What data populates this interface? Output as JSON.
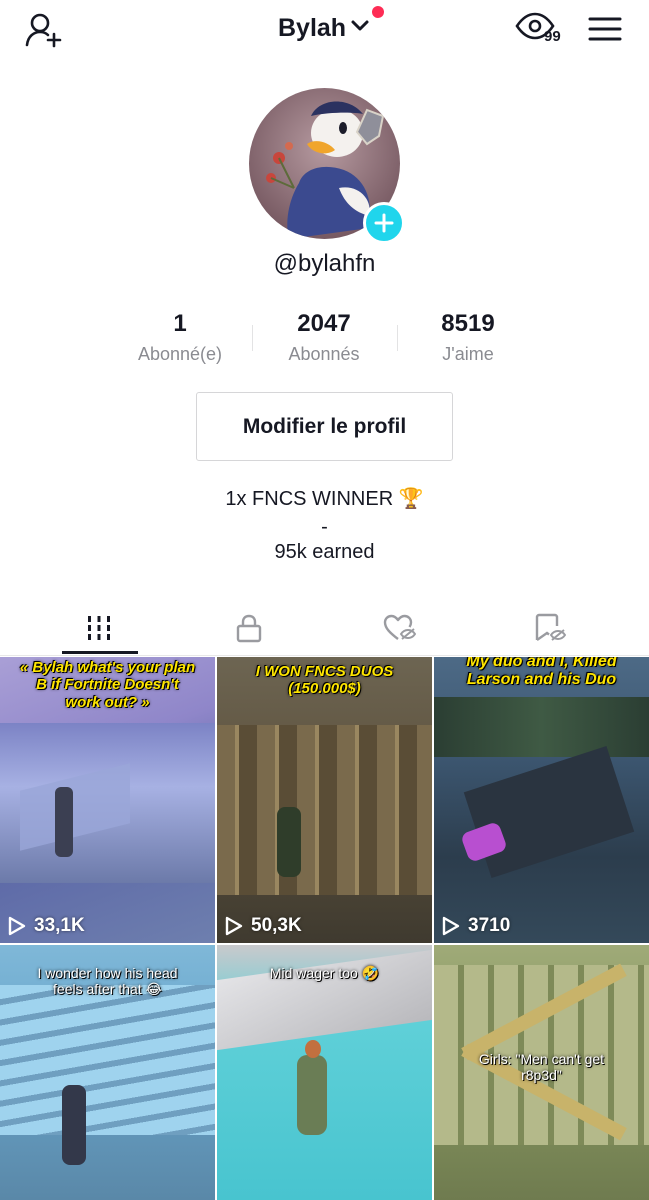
{
  "header": {
    "username": "Bylah",
    "viewers_count": "99",
    "icons": {
      "add_user": "add-user-icon",
      "profile_views": "eye-icon",
      "menu": "hamburger-menu-icon",
      "dropdown": "chevron-down-icon"
    },
    "notification_color": "#fe2c55"
  },
  "profile": {
    "handle": "@bylahfn",
    "avatar_icon": "avatar-image",
    "plus_color": "#20d5ec",
    "edit_button_label": "Modifier le profil",
    "bio_line1": "1x FNCS WINNER 🏆",
    "bio_line2": "-",
    "bio_line3": "95k earned"
  },
  "stats": [
    {
      "value": "1",
      "label": "Abonné(e)"
    },
    {
      "value": "2047",
      "label": "Abonnés"
    },
    {
      "value": "8519",
      "label": "J'aime"
    }
  ],
  "tabs": [
    {
      "icon": "grid-videos-icon",
      "active": true
    },
    {
      "icon": "lock-icon",
      "active": false
    },
    {
      "icon": "liked-heart-hidden-icon",
      "active": false
    },
    {
      "icon": "bookmark-hidden-icon",
      "active": false
    }
  ],
  "videos": [
    {
      "caption": "« Bylah what's your plan B if Fortnite Doesn't work out? »",
      "views": "33,1K"
    },
    {
      "caption": "I WON FNCS DUOS (150.000$)",
      "views": "50,3K"
    },
    {
      "caption": "My duo and I, Killed Larson and his Duo",
      "views": "3710"
    },
    {
      "caption": "I wonder how his head feels after that 😂",
      "views": ""
    },
    {
      "caption": "Mid wager too 🤣",
      "views": ""
    },
    {
      "caption": "Girls: \"Men can't get r8p3d\"",
      "views": ""
    }
  ]
}
